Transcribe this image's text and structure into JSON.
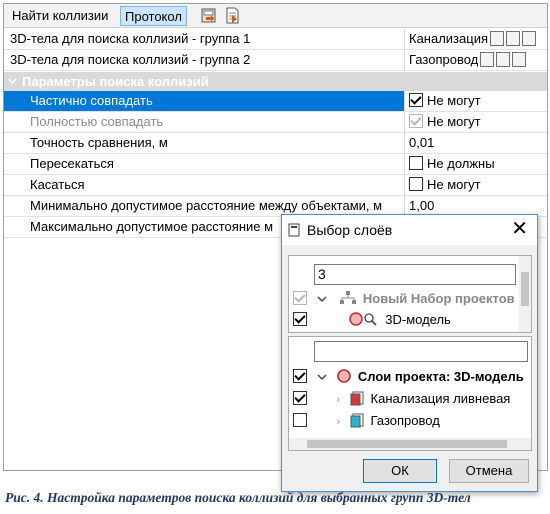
{
  "toolbar": {
    "find_collisions": "Найти коллизии",
    "protocol": "Протокол",
    "export_icon": "export-icon",
    "report_icon": "report-icon"
  },
  "groups": [
    {
      "label": "3D-тела для поиска коллизий - группа 1",
      "value": "Канализация"
    },
    {
      "label": "3D-тела для поиска коллизий - группа 2",
      "value": "Газопровод"
    }
  ],
  "params": {
    "category": "Параметры поиска коллизий",
    "rows": [
      {
        "label": "Частично совпадать",
        "value": "Не могут",
        "checked": true,
        "selected": true
      },
      {
        "label": "Полностью совпадать",
        "value": "Не могут",
        "checked": true,
        "disabled": true
      },
      {
        "label": "Точность сравнения, м",
        "value": "0,01"
      },
      {
        "label": "Пересекаться",
        "value": "Не должны",
        "checked": false
      },
      {
        "label": "Касаться",
        "value": "Не могут",
        "checked": false
      },
      {
        "label": "Минимально допустимое расстояние между объектами, м",
        "value": "1,00"
      },
      {
        "label": "Максимально допустимое расстояние м",
        "value": ""
      }
    ]
  },
  "dialog": {
    "title": "Выбор слоёв",
    "search_value": "3",
    "project_sets": [
      {
        "label": "Новый Набор проектов"
      },
      {
        "label": "3D-модель"
      }
    ],
    "filter_value": "",
    "layers": [
      {
        "label": "Слои проекта: 3D-модель"
      },
      {
        "label": "Канализация ливневая"
      },
      {
        "label": "Газопровод"
      }
    ],
    "ok": "ОК",
    "cancel": "Отмена"
  },
  "caption": "Рис. 4. Настройка параметров поиска коллизий для выбранных групп 3D-тел",
  "colors": {
    "selection": "#0078d7",
    "category_bg": "#d9d9d9",
    "caption": "#1f3864"
  }
}
